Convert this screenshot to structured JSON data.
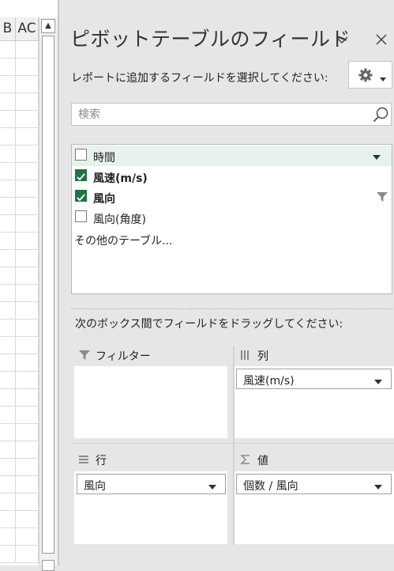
{
  "sheet": {
    "columns": [
      "B",
      "AC"
    ]
  },
  "pane": {
    "title": "ピボットテーブルのフィールド",
    "choose_label": "レポートに追加するフィールドを選択してください:",
    "search_placeholder": "検索",
    "fields": [
      {
        "label": "時間",
        "checked": false,
        "bold": false,
        "highlighted": true,
        "filter": false,
        "dropdown": true
      },
      {
        "label": "風速(m/s)",
        "checked": true,
        "bold": true,
        "highlighted": false,
        "filter": false,
        "dropdown": false
      },
      {
        "label": "風向",
        "checked": true,
        "bold": true,
        "highlighted": false,
        "filter": true,
        "dropdown": false
      },
      {
        "label": "風向(角度)",
        "checked": false,
        "bold": false,
        "highlighted": false,
        "filter": false,
        "dropdown": false
      }
    ],
    "more_tables": "その他のテーブル...",
    "drag_label": "次のボックス間でフィールドをドラッグしてください:",
    "areas": {
      "filters": {
        "title": "フィルター",
        "icon": "filter-icon"
      },
      "columns": {
        "title": "列",
        "icon": "columns-icon",
        "chip": "風速(m/s)"
      },
      "rows": {
        "title": "行",
        "icon": "rows-icon",
        "chip": "風向"
      },
      "values": {
        "title": "値",
        "icon": "sigma-icon",
        "chip": "個数 / 風向"
      }
    }
  },
  "colors": {
    "accent_green": "#217346",
    "pane_background": "#e6e6e6",
    "highlight_row": "#e8f2ec"
  }
}
